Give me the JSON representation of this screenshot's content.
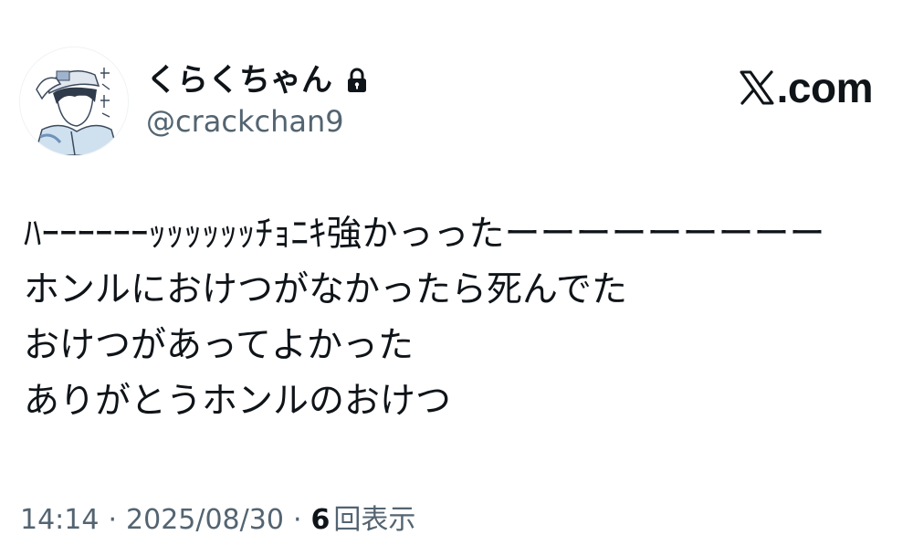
{
  "author": {
    "display_name": "くらくちゃん",
    "handle": "@crackchan9",
    "avatar_icon": "avatar-illustration",
    "protected_icon": "lock-icon"
  },
  "brand": {
    "logo_icon": "x-logo-icon",
    "text": ".com"
  },
  "tweet": {
    "lines": [
      "ﾊｰｰｰｰｰｰｯｯｯｯｯｯﾁｮﾆｷ強かっったーーーーーーーーー",
      "ホンルにおけつがなかったら死んでた",
      "おけつがあってよかった",
      "ありがとうホンルのおけつ"
    ]
  },
  "meta": {
    "time": "14:14",
    "separator": "·",
    "date": "2025/08/30",
    "views_count": "6",
    "views_label": "回表示"
  },
  "colors": {
    "text_primary": "#0f1419",
    "text_secondary": "#536471",
    "background": "#ffffff"
  }
}
